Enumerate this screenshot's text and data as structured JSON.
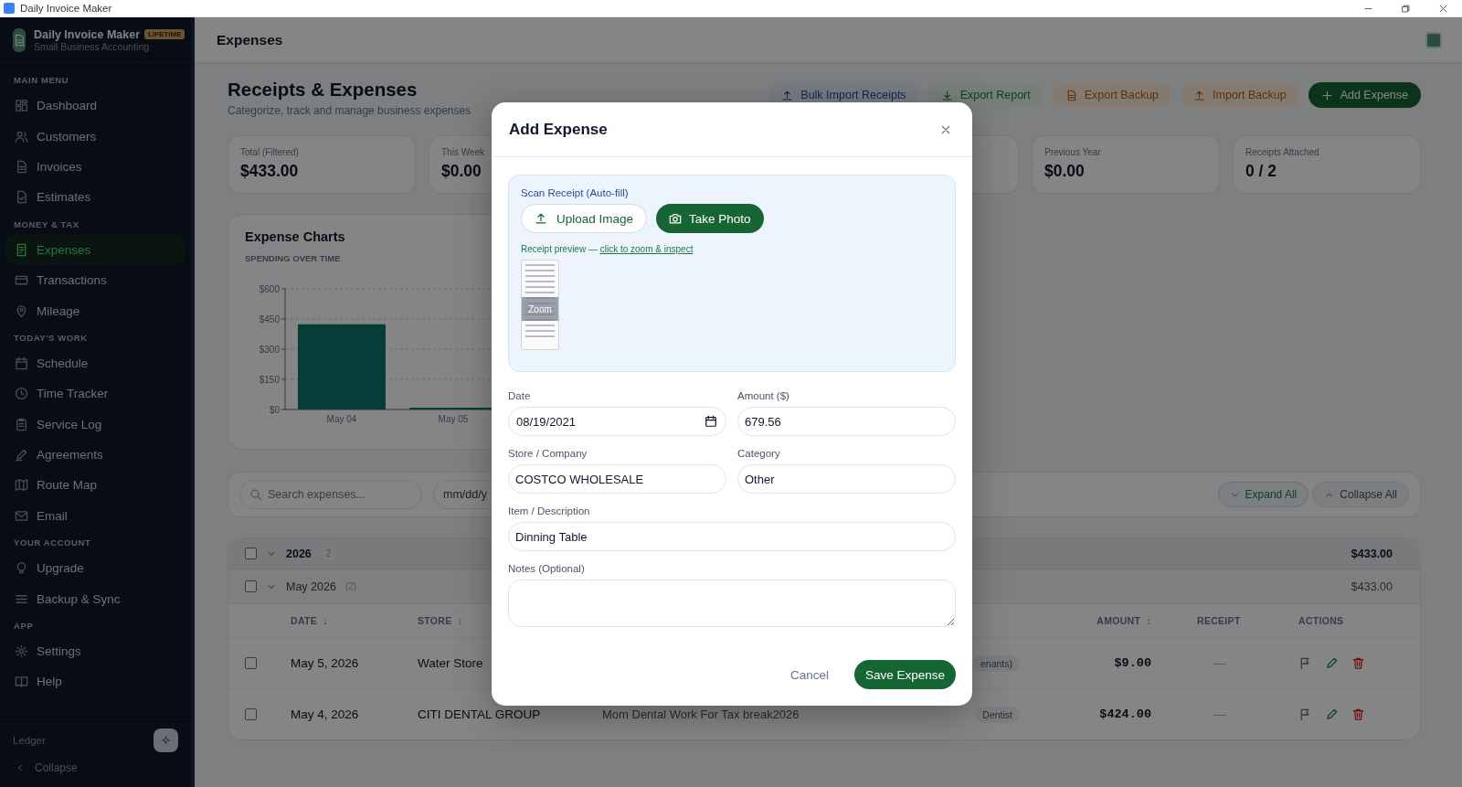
{
  "window": {
    "title": "Daily Invoice Maker"
  },
  "sidebar": {
    "app_name": "Daily Invoice Maker",
    "badge": "LIFETIME",
    "tagline": "Small Business Accounting",
    "sections": [
      {
        "label": "MAIN MENU",
        "items": [
          {
            "label": "Dashboard",
            "selected": false
          },
          {
            "label": "Customers",
            "selected": false
          },
          {
            "label": "Invoices",
            "selected": false
          },
          {
            "label": "Estimates",
            "selected": false
          }
        ]
      },
      {
        "label": "MONEY & TAX",
        "items": [
          {
            "label": "Expenses",
            "selected": true
          },
          {
            "label": "Transactions",
            "selected": false
          },
          {
            "label": "Mileage",
            "selected": false
          }
        ]
      },
      {
        "label": "TODAY'S WORK",
        "items": [
          {
            "label": "Schedule",
            "selected": false
          },
          {
            "label": "Time Tracker",
            "selected": false
          },
          {
            "label": "Service Log",
            "selected": false
          },
          {
            "label": "Agreements",
            "selected": false
          },
          {
            "label": "Route Map",
            "selected": false
          },
          {
            "label": "Email",
            "selected": false
          }
        ]
      },
      {
        "label": "YOUR ACCOUNT",
        "items": [
          {
            "label": "Upgrade",
            "selected": false
          },
          {
            "label": "Backup & Sync",
            "selected": false
          }
        ]
      },
      {
        "label": "APP",
        "items": [
          {
            "label": "Settings",
            "selected": false
          },
          {
            "label": "Help",
            "selected": false
          }
        ]
      }
    ],
    "footer_label": "Ledger",
    "collapse": "Collapse"
  },
  "header": {
    "title": "Expenses"
  },
  "page": {
    "title": "Receipts & Expenses",
    "subtitle": "Categorize, track and manage business expenses",
    "actions": [
      {
        "label": "Bulk Import Receipts",
        "kind": "info"
      },
      {
        "label": "Export Report",
        "kind": "success"
      },
      {
        "label": "Export Backup",
        "kind": "warning"
      },
      {
        "label": "Import Backup",
        "kind": "warning"
      },
      {
        "label": "Add Expense",
        "kind": "primary"
      }
    ]
  },
  "stats_left": [
    {
      "label": "Total (Filtered)",
      "value": "$433.00"
    },
    {
      "label": "This Week",
      "value": "$0.00"
    }
  ],
  "stats_right": [
    {
      "label": "Previous Year",
      "value": "$0.00"
    },
    {
      "label": "Receipts Attached",
      "value": "0 / 2"
    }
  ],
  "chart_card": {
    "title": "Expense Charts",
    "subtitle": "SPENDING OVER TIME",
    "chart_data": {
      "type": "bar",
      "categories": [
        "May 04",
        "May 05"
      ],
      "series": [
        {
          "color": "#0f766e",
          "values": [
            424,
            9
          ]
        }
      ],
      "grid": true,
      "ylim": [
        0,
        600
      ],
      "yticks": [
        {
          "value": 0,
          "label": "$0"
        },
        {
          "value": 150,
          "label": "$150"
        },
        {
          "value": 300,
          "label": "$300"
        },
        {
          "value": 450,
          "label": "$450"
        },
        {
          "value": 600,
          "label": "$600"
        }
      ]
    }
  },
  "filters": {
    "search": {
      "placeholder": "Search expenses..."
    },
    "date": {
      "placeholder": "mm/dd/y"
    },
    "expand": "Expand All",
    "collapse": "Collapse All"
  },
  "groups": [
    {
      "label": "2026",
      "count": "2",
      "total": "$433.00",
      "checked": false,
      "expanded": true
    },
    {
      "label": "May 2026",
      "count": "(2)",
      "total": "$433.00",
      "checked": false,
      "expanded": true
    }
  ],
  "table": {
    "columns": [
      {
        "label": "DATE",
        "sort": "↓",
        "kind": "date"
      },
      {
        "label": "STORE",
        "sort": "↕",
        "kind": "store"
      },
      {
        "label": "AMOUNT",
        "sort": "↕",
        "kind": "amount"
      },
      {
        "label": "RECEIPT",
        "kind": "receipt"
      },
      {
        "label": "ACTIONS",
        "kind": "actions"
      }
    ],
    "rows": [
      {
        "checked": false,
        "date": "May 5, 2026",
        "store": "Water Store",
        "tag": "enants)",
        "amount": "$9.00",
        "receipt": "—"
      },
      {
        "checked": false,
        "date": "May 4, 2026",
        "store": "CITI DENTAL GROUP",
        "description": "Mom Dental Work For Tax break2026",
        "tag": "Dentist",
        "amount": "$424.00",
        "receipt": "—"
      }
    ]
  },
  "dialog": {
    "title": "Add Expense",
    "scan": {
      "label": "Scan Receipt (Auto-fill)",
      "upload": "Upload Image",
      "photo": "Take Photo",
      "preview_text": "Receipt preview — ",
      "preview_link": "click to zoom & inspect",
      "zoom_label": "Zoom"
    },
    "fields": [
      {
        "label": "Date",
        "value": "08/19/2021",
        "kind": "date"
      },
      {
        "label": "Amount ($)",
        "value": "679.56",
        "kind": "text"
      },
      {
        "label": "Store / Company",
        "value": "COSTCO WHOLESALE",
        "kind": "text"
      },
      {
        "label": "Category",
        "value": "Other",
        "kind": "text"
      },
      {
        "label": "Item / Description",
        "value": "Dinning Table",
        "kind": "wide"
      },
      {
        "label": "Notes (Optional)",
        "kind": "textarea"
      }
    ],
    "cancel": "Cancel",
    "save": "Save Expense"
  }
}
